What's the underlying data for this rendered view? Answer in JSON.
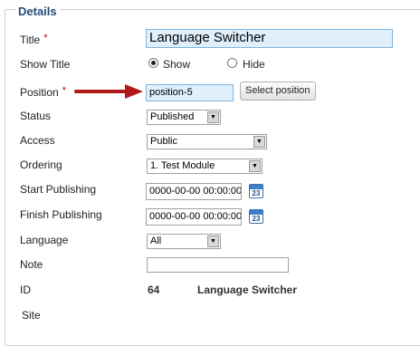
{
  "legend": "Details",
  "fields": {
    "title": {
      "label": "Title",
      "required_mark": "*",
      "value": "Language Switcher"
    },
    "show_title": {
      "label": "Show Title",
      "options": [
        {
          "label": "Show",
          "selected": true
        },
        {
          "label": "Hide",
          "selected": false
        }
      ]
    },
    "position": {
      "label": "Position",
      "required_mark": "*",
      "value": "position-5",
      "button_label": "Select position"
    },
    "status": {
      "label": "Status",
      "value": "Published"
    },
    "access": {
      "label": "Access",
      "value": "Public"
    },
    "ordering": {
      "label": "Ordering",
      "value": "1. Test Module"
    },
    "start_publishing": {
      "label": "Start Publishing",
      "value": "0000-00-00 00:00:00",
      "calendar_day": "23"
    },
    "finish_publishing": {
      "label": "Finish Publishing",
      "value": "0000-00-00 00:00:00",
      "calendar_day": "23"
    },
    "language": {
      "label": "Language",
      "value": "All"
    },
    "note": {
      "label": "Note",
      "value": ""
    },
    "id": {
      "label": "ID",
      "value": "64",
      "module_name": "Language Switcher"
    },
    "site": {
      "label": "Site"
    }
  },
  "colors": {
    "arrow": "#b01818",
    "legend": "#224c7a",
    "highlight_input": "#dfeffc"
  }
}
